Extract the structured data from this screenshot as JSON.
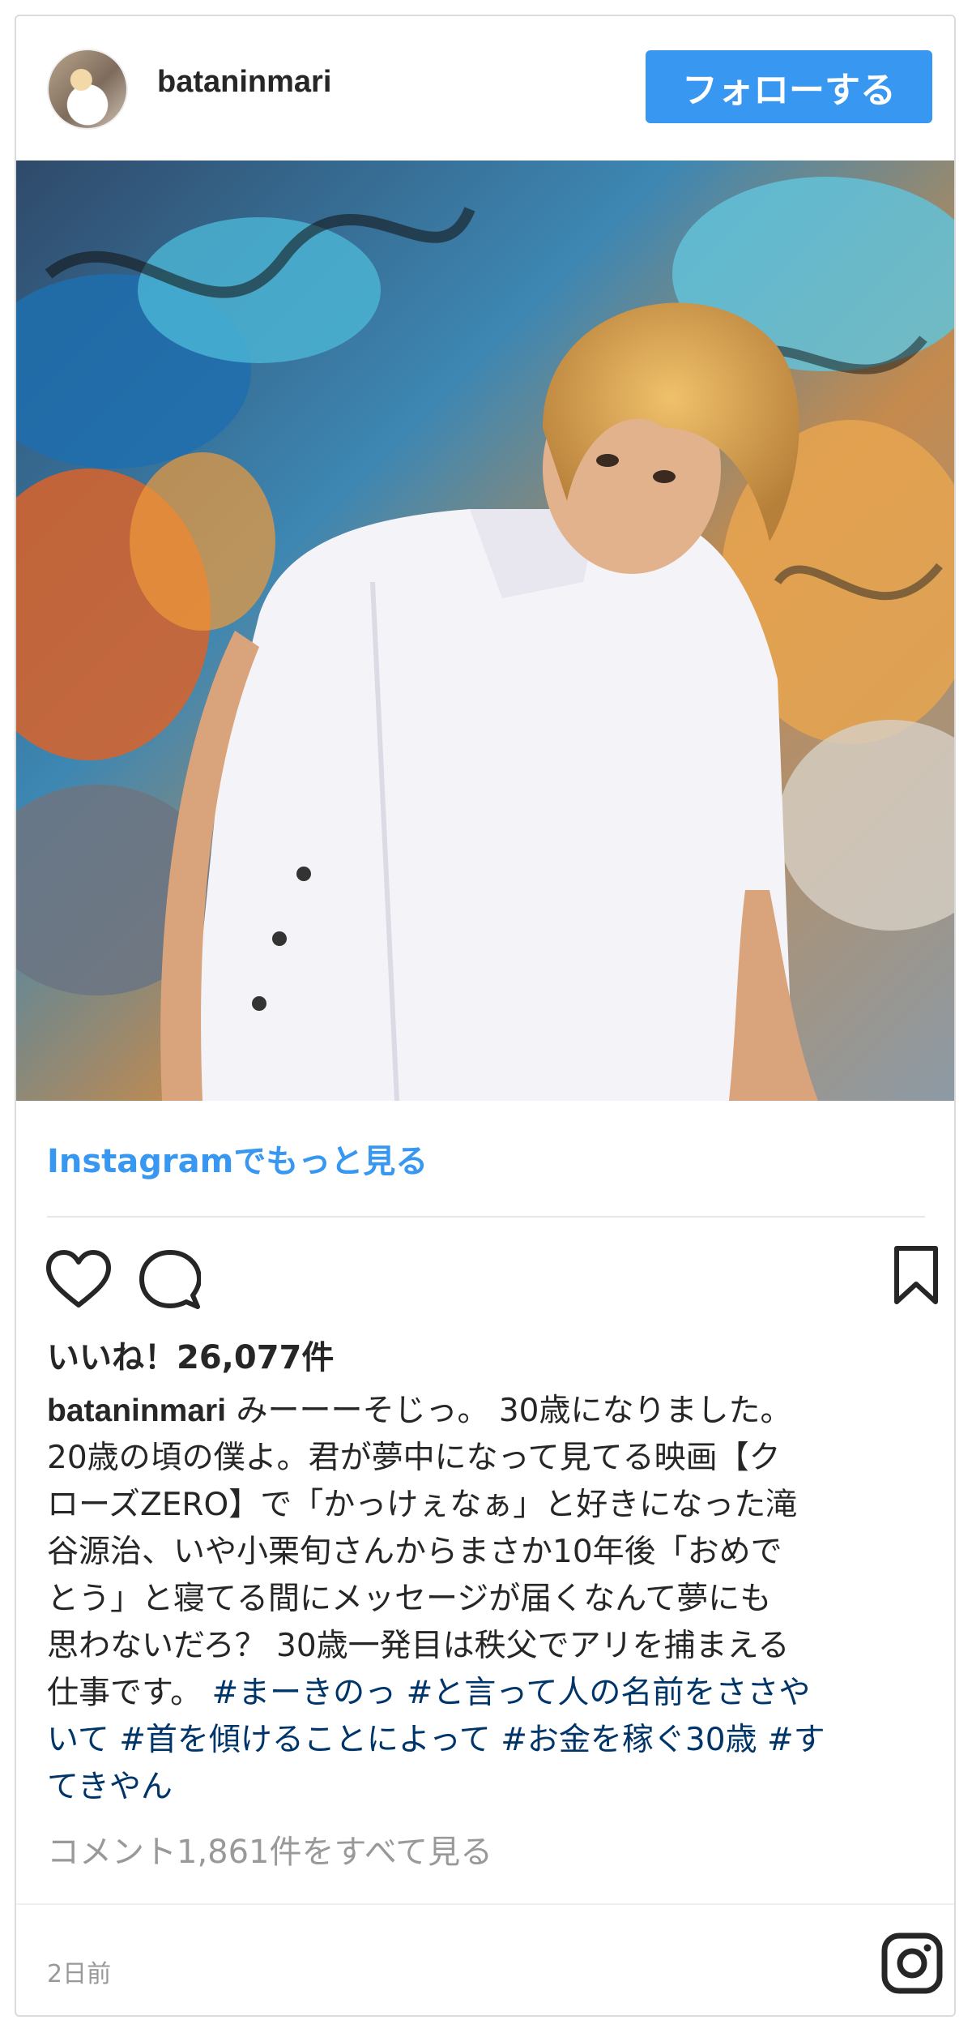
{
  "header": {
    "username": "batanin­mari",
    "follow_label": "フォローする"
  },
  "post": {
    "more_link": "Instagramでもっと見る",
    "likes": "いいね！26,077件",
    "caption_user": "bataninmari",
    "caption_lines": [
      " みーーーそじっ。 30歳になりました。",
      "20歳の頃の僕よ。君が夢中になって見てる映画【ク",
      "ローズZERO】で「かっけぇなぁ」と好きになった滝",
      "谷源治、いや小栗旬さんからまさか10年後「おめで",
      "とう」と寝てる間にメッセージが届くなんて夢にも",
      "思わないだろ？ 30歳一発目は秩父でアリを捕まえる"
    ],
    "caption_line7_text": "仕事です。 ",
    "hashtags": [
      "#まーきのっ",
      "#と言って人の名前をささや",
      "いて",
      "#首を傾けることによって",
      "#お金を稼ぐ30歳",
      "#す",
      "てきやん"
    ],
    "comments_link": "コメント1,861件をすべて見る",
    "time": "2日前"
  },
  "icons": {
    "like": "heart-icon",
    "comment": "comment-bubble-icon",
    "save": "bookmark-icon",
    "brand": "instagram-logo-icon"
  },
  "colors": {
    "follow_button": "#3897f0",
    "link": "#3897f0",
    "hashtag": "#003569",
    "muted": "#999999"
  }
}
